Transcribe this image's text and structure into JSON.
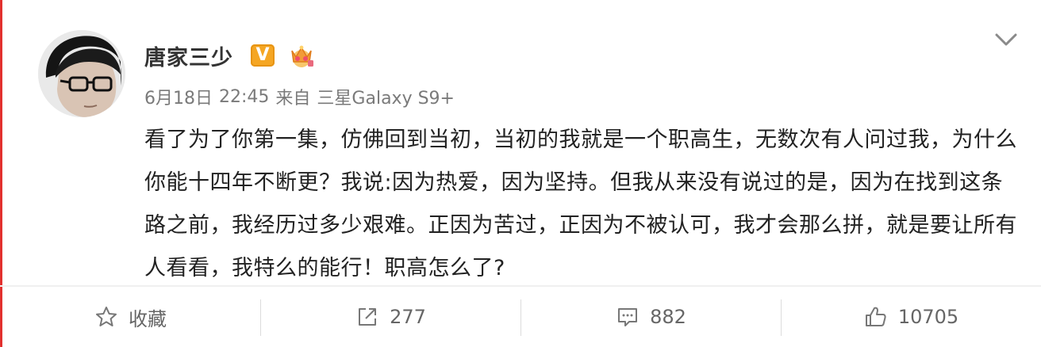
{
  "post": {
    "author": {
      "name": "唐家三少",
      "badges": [
        "verified-v-icon",
        "crown-member-icon"
      ]
    },
    "meta": {
      "date": "6月18日",
      "time": "22:45",
      "source_prefix": "来自",
      "device": "三星Galaxy S9+"
    },
    "content": "看了为了你第一集，仿佛回到当初，当初的我就是一个职高生，无数次有人问过我，为什么你能十四年不断更？我说:因为热爱，因为坚持。但我从来没有说过的是，因为在找到这条路之前，我经历过多少艰难。正因为苦过，正因为不被认可，我才会那么拼，就是要让所有人看看，我特么的能行！职高怎么了?",
    "actions": {
      "favorite_label": "收藏",
      "repost_count": "277",
      "comment_count": "882",
      "like_count": "10705"
    }
  },
  "colors": {
    "accent": "#e2302e",
    "verified_badge": "#f5a623",
    "meta_text": "#7a7a7a",
    "action_text": "#666666"
  },
  "icons": {
    "more": "chevron-down-icon",
    "favorite": "star-icon",
    "repost": "share-icon",
    "comment": "comment-icon",
    "like": "thumbs-up-icon"
  }
}
